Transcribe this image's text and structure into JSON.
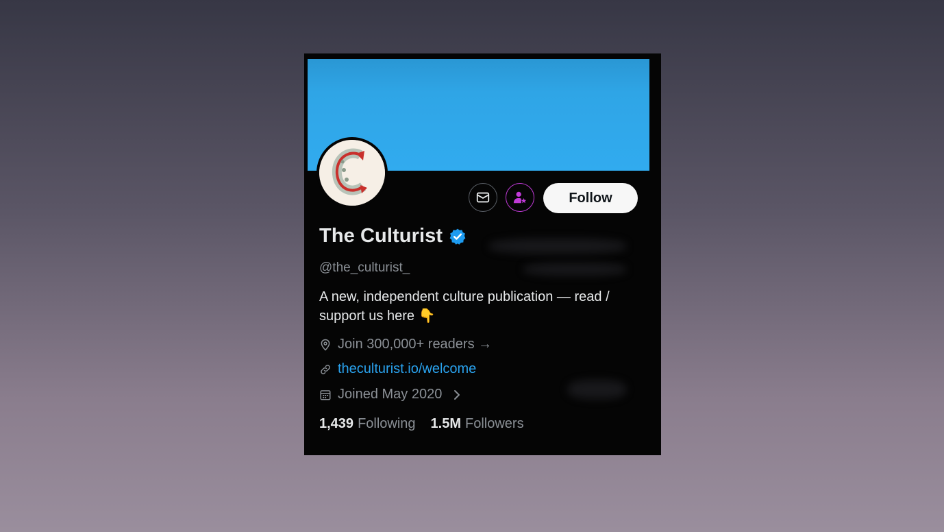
{
  "profile": {
    "display_name": "The Culturist",
    "handle": "@the_culturist_",
    "bio": "A new, independent culture publication — read / support us here 👇",
    "location": "Join 300,000+ readers →",
    "website": "theculturist.io/welcome",
    "joined": "Joined May 2020",
    "avatar_letter": "C",
    "verified": true
  },
  "actions": {
    "message_icon": "envelope-icon",
    "subscribe_icon": "subscribe-person-star-icon",
    "follow_label": "Follow"
  },
  "stats": {
    "following_count": "1,439",
    "following_label": "Following",
    "followers_count": "1.5M",
    "followers_label": "Followers"
  },
  "colors": {
    "banner": "#31abef",
    "background": "#050505",
    "link": "#2aa3ef",
    "verified": "#1d9bf0",
    "subscribe_accent": "#c13ad8"
  }
}
